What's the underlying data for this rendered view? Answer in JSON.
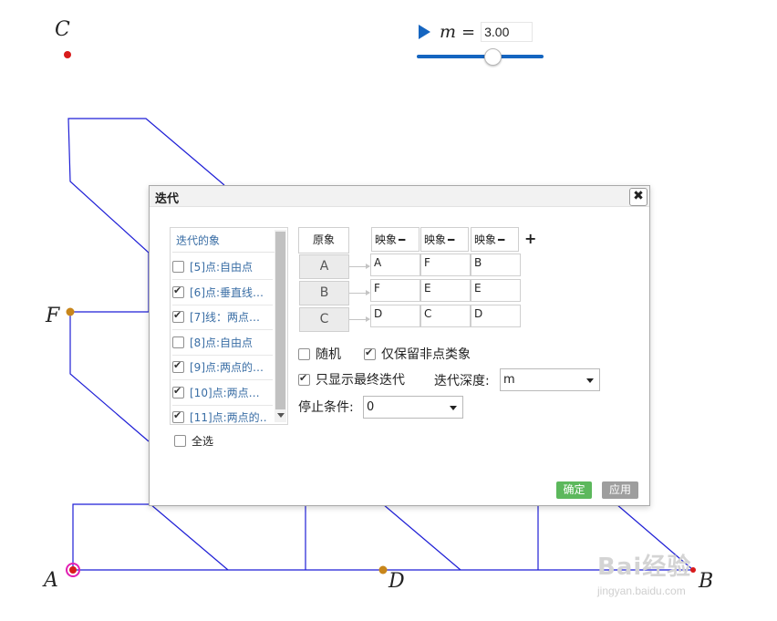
{
  "points": {
    "a": "A",
    "b": "B",
    "c": "C",
    "d": "D",
    "f": "F"
  },
  "slider": {
    "variable": "m",
    "equals": "=",
    "value": "3.00",
    "value_numeric": 3.0
  },
  "dialog": {
    "title": "迭代",
    "close_symbol": "✖",
    "object_list": {
      "header": "迭代的象",
      "items": [
        {
          "label": "[5]点:自由点",
          "checked": false
        },
        {
          "label": "[6]点:垂直线…",
          "checked": true
        },
        {
          "label": "[7]线：两点…",
          "checked": true
        },
        {
          "label": "[8]点:自由点",
          "checked": false
        },
        {
          "label": "[9]点:两点的…",
          "checked": true
        },
        {
          "label": "[10]点:两点…",
          "checked": true
        },
        {
          "label": "[11]点:两点的…",
          "checked": true
        }
      ],
      "select_all": "全选"
    },
    "mapping": {
      "original_header": "原象",
      "image_header": "映象",
      "minus_symbol": "━",
      "add_symbol": "+",
      "originals": [
        "A",
        "B",
        "C"
      ],
      "images": [
        [
          "A",
          "F",
          "B"
        ],
        [
          "F",
          "E",
          "E"
        ],
        [
          "D",
          "C",
          "D"
        ]
      ]
    },
    "options": {
      "random": "随机",
      "random_checked": false,
      "keep_non_point": "仅保留非点类象",
      "keep_non_point_checked": true,
      "final_only": "只显示最终迭代",
      "final_only_checked": true,
      "depth_label": "迭代深度:",
      "depth_value": "m",
      "stop_label": "停止条件:",
      "stop_value": "0"
    },
    "buttons": {
      "ok": "确定",
      "apply": "应用"
    }
  },
  "watermark": {
    "main": "Bai经验",
    "sub": "jingyan.baidu.com"
  },
  "colors": {
    "line": "#1f1fd6",
    "point_orange": "#c8861b",
    "point_red": "#d81b1b",
    "highlight": "#e11fb4",
    "slider": "#1565c0"
  }
}
